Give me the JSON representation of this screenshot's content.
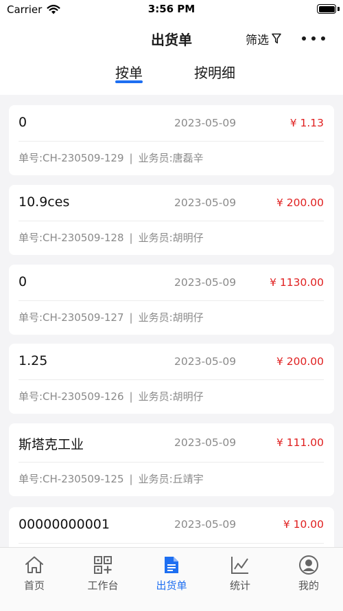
{
  "status_bar": {
    "carrier": "Carrier",
    "time": "3:56 PM"
  },
  "nav": {
    "title": "出货单",
    "filter_label": "筛选"
  },
  "tabs": [
    {
      "label": "按单"
    },
    {
      "label": "按明细"
    }
  ],
  "orders": [
    {
      "name": "0",
      "date": "2023-05-09",
      "amount": "¥ 1.13",
      "order_no": "单号:CH-230509-129",
      "separator": "|",
      "salesperson": "业务员:唐磊辛"
    },
    {
      "name": "10.9ces",
      "date": "2023-05-09",
      "amount": "¥ 200.00",
      "order_no": "单号:CH-230509-128",
      "separator": "|",
      "salesperson": "业务员:胡明仔"
    },
    {
      "name": "0",
      "date": "2023-05-09",
      "amount": "¥ 1130.00",
      "order_no": "单号:CH-230509-127",
      "separator": "|",
      "salesperson": "业务员:胡明仔"
    },
    {
      "name": "1.25",
      "date": "2023-05-09",
      "amount": "¥ 200.00",
      "order_no": "单号:CH-230509-126",
      "separator": "|",
      "salesperson": "业务员:胡明仔"
    },
    {
      "name": "斯塔克工业",
      "date": "2023-05-09",
      "amount": "¥ 111.00",
      "order_no": "单号:CH-230509-125",
      "separator": "|",
      "salesperson": "业务员:丘靖宇"
    },
    {
      "name": "00000000001",
      "date": "2023-05-09",
      "amount": "¥ 10.00",
      "order_no": "",
      "separator": "",
      "salesperson": ""
    }
  ],
  "tab_bar": [
    {
      "label": "首页",
      "icon": "home-icon"
    },
    {
      "label": "工作台",
      "icon": "qr-grid-icon"
    },
    {
      "label": "出货单",
      "icon": "document-icon"
    },
    {
      "label": "统计",
      "icon": "chart-icon"
    },
    {
      "label": "我的",
      "icon": "user-icon"
    }
  ],
  "colors": {
    "accent": "#1e6ff1",
    "amount": "#e02020",
    "muted": "#8a8a8a"
  }
}
